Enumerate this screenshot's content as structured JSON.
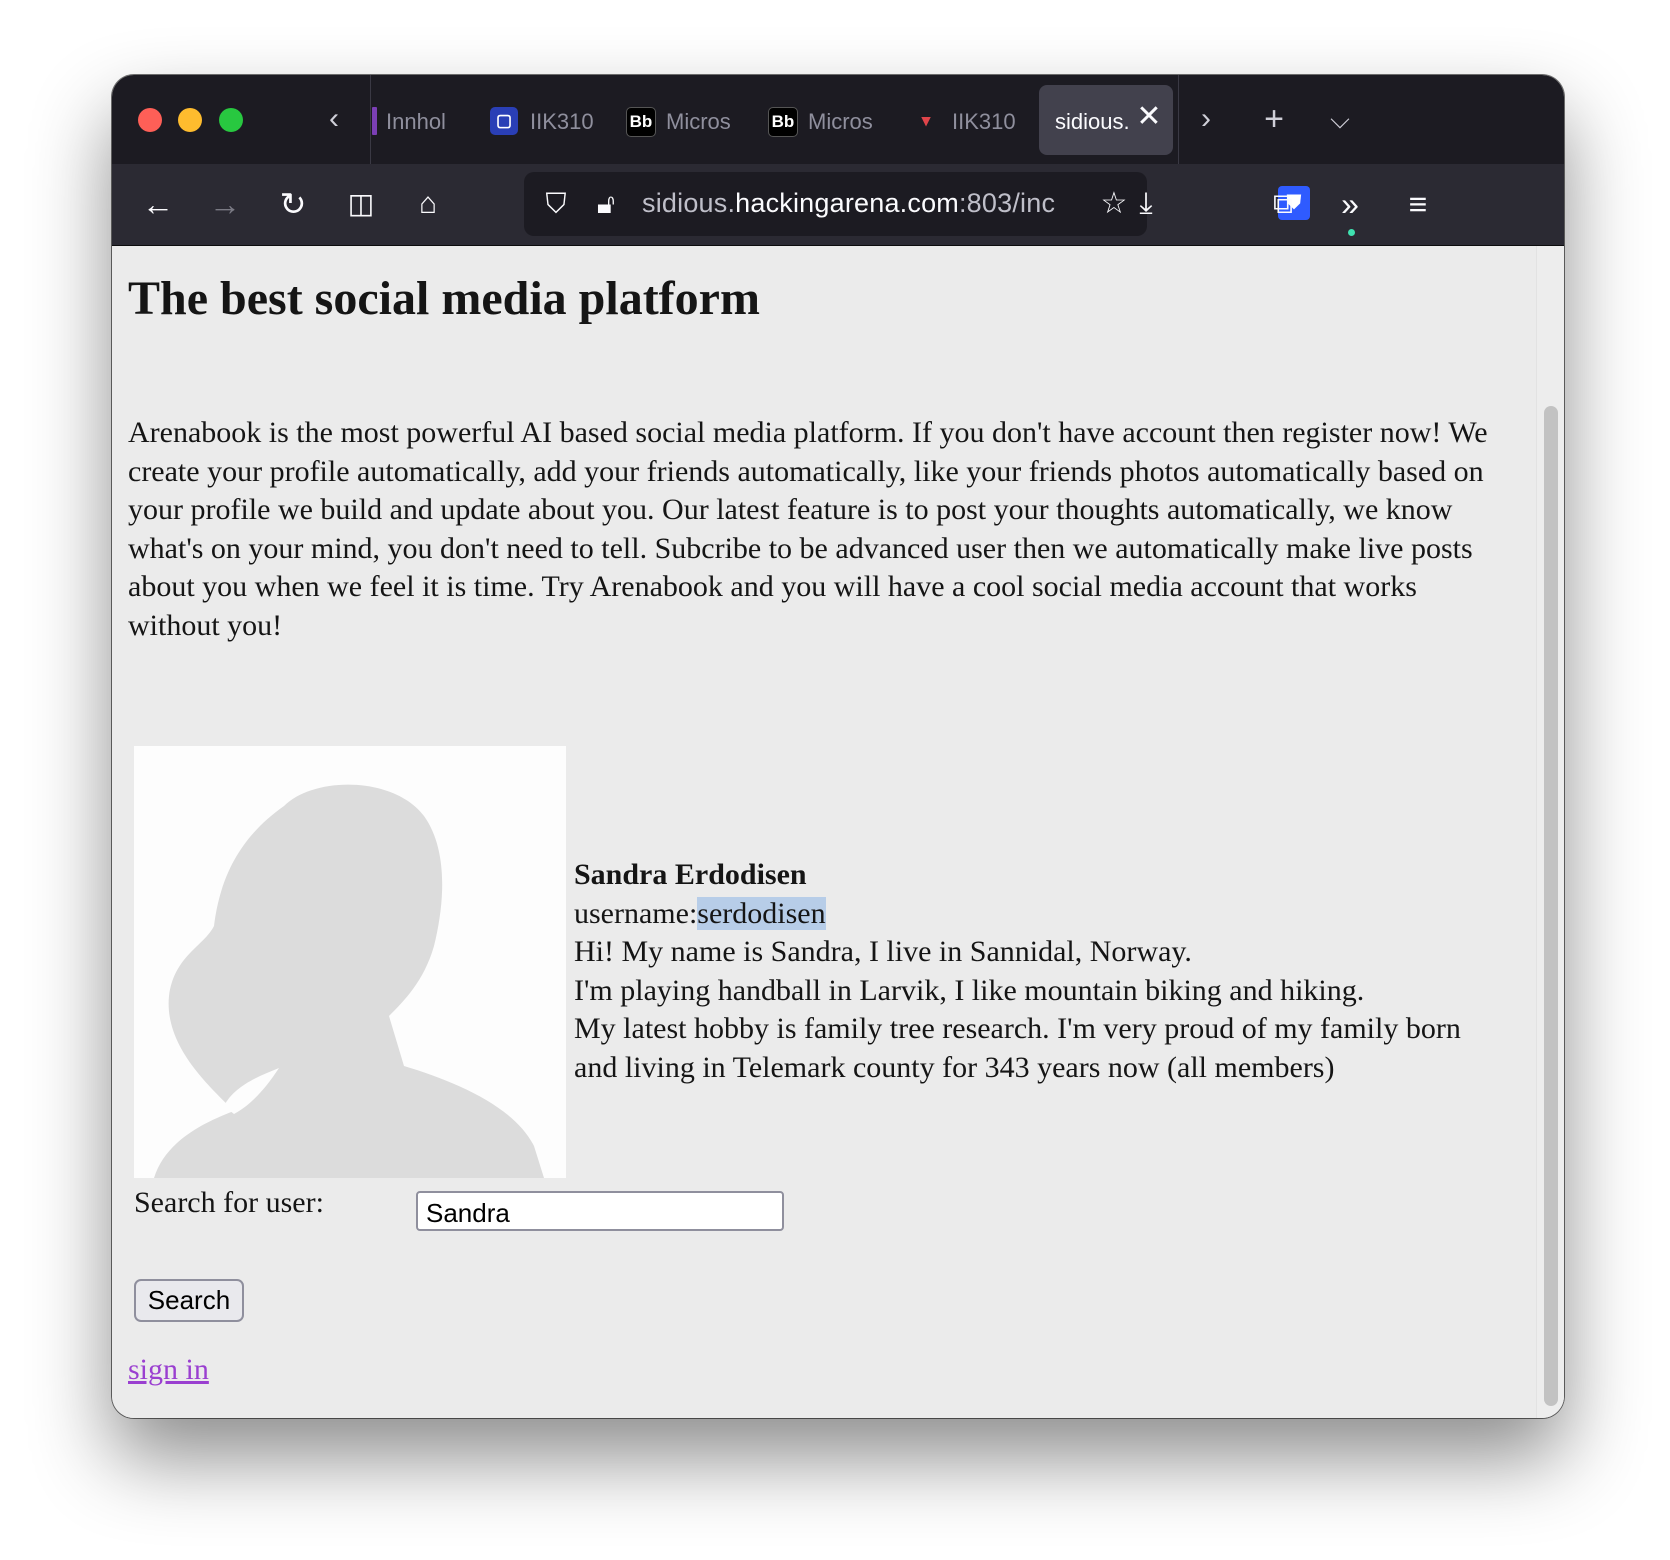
{
  "browser": {
    "tabs": [
      {
        "title": "Innhol",
        "icon": "purple-bar-icon"
      },
      {
        "title": "IIK310",
        "icon": "blue-square-icon"
      },
      {
        "title": "Micros",
        "icon": "bb-icon",
        "icon_text": "Bb"
      },
      {
        "title": "Micros",
        "icon": "bb-icon",
        "icon_text": "Bb"
      },
      {
        "title": "IIK310",
        "icon": "pin-icon"
      },
      {
        "title": "sidious.",
        "active": true
      }
    ],
    "url": {
      "prefix": "sidious.",
      "domain": "hackingarena.com",
      "rest": ":803/inc"
    }
  },
  "page": {
    "heading": "The best social media platform",
    "intro": "Arenabook is the most powerful AI based social media platform. If you don't have account then register now! We create your profile automatically, add your friends automatically, like your friends photos automatically based on your profile we build and update about you. Our latest feature is to post your thoughts automatically, we know what's on your mind, you don't need to tell. Subcribe to be advanced user then we automatically make live posts about you when we feel it is time. Try Arenabook and you will have a cool social media account that works without you!",
    "profile": {
      "name": "Sandra Erdodisen",
      "username_label": "username:",
      "username": "serdodisen",
      "bio_lines": [
        "Hi! My name is Sandra, I live in Sannidal, Norway.",
        "I'm playing handball in Larvik, I like mountain biking and hiking.",
        "My latest hobby is family tree research. I'm very proud of my family born and living in Telemark county for 343 years now (all members)"
      ]
    },
    "search": {
      "label": "Search for user:",
      "value": "Sandra",
      "button": "Search"
    },
    "signin_link": "sign in"
  },
  "colors": {
    "link": "#9a3fd0",
    "selection": "#b7cde8",
    "tabbar": "#1c1b22",
    "toolbar": "#2b2a33"
  }
}
